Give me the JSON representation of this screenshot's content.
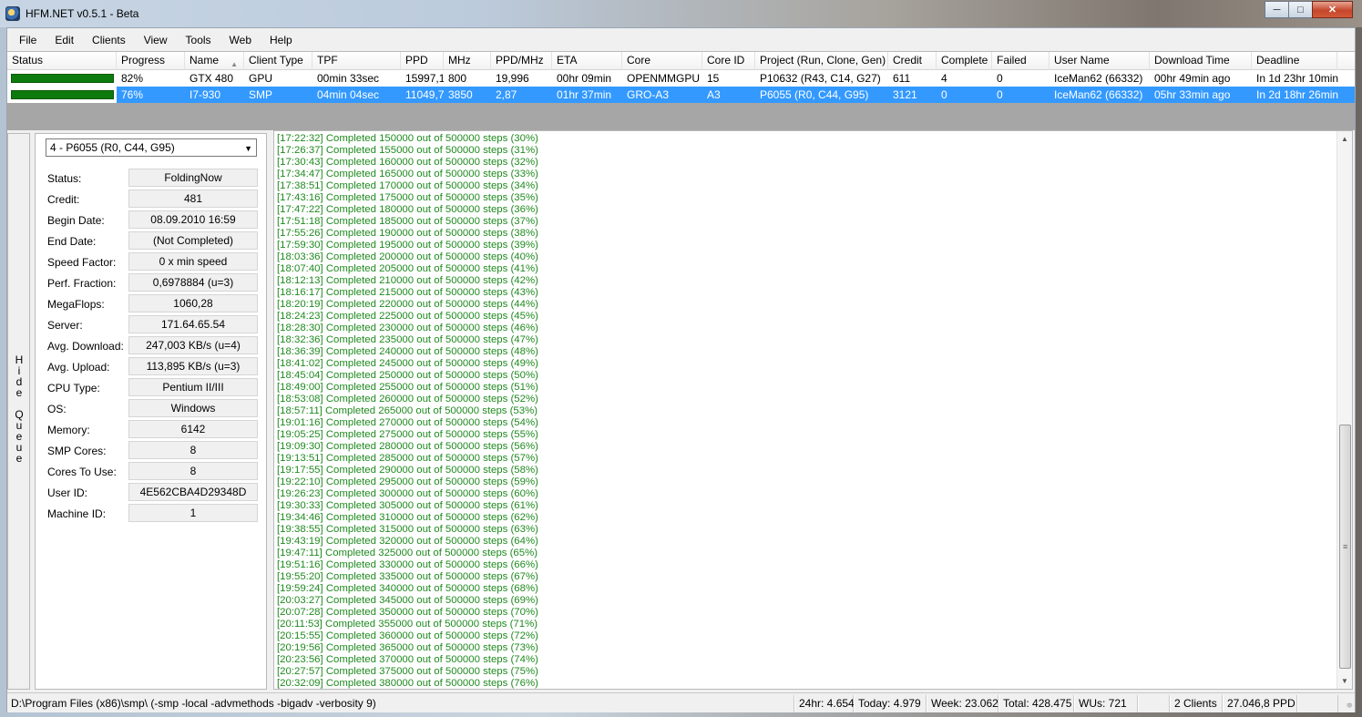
{
  "window": {
    "title": "HFM.NET v0.5.1 - Beta"
  },
  "menu": [
    "File",
    "Edit",
    "Clients",
    "View",
    "Tools",
    "Web",
    "Help"
  ],
  "grid": {
    "columns": [
      "Status",
      "Progress",
      "Name",
      "Client Type",
      "TPF",
      "PPD",
      "MHz",
      "PPD/MHz",
      "ETA",
      "Core",
      "Core ID",
      "Project (Run, Clone, Gen)",
      "Credit",
      "Complete",
      "Failed",
      "User Name",
      "Download Time",
      "Deadline"
    ],
    "rows": [
      [
        "",
        "82%",
        "GTX 480",
        "GPU",
        "00min 33sec",
        "15997,1",
        "800",
        "19,996",
        "00hr 09min",
        "OPENMMGPU",
        "15",
        "P10632 (R43, C14, G27)",
        "611",
        "4",
        "0",
        "IceMan62 (66332)",
        "00hr 49min ago",
        "In 1d 23hr 10min"
      ],
      [
        "",
        "76%",
        "I7-930",
        "SMP",
        "04min 04sec",
        "11049,7",
        "3850",
        "2,87",
        "01hr 37min",
        "GRO-A3",
        "A3",
        "P6055 (R0, C44, G95)",
        "3121",
        "0",
        "0",
        "IceMan62 (66332)",
        "05hr 33min ago",
        "In 2d 18hr 26min"
      ]
    ],
    "status_color": "#0d7a0d",
    "selection_color": "#3399ff"
  },
  "hide_queue": {
    "label": "Hide Queue"
  },
  "queue": {
    "selected": "4 - P6055 (R0, C44, G95)",
    "fields": [
      {
        "label": "Status:",
        "value": "FoldingNow"
      },
      {
        "label": "Credit:",
        "value": "481"
      },
      {
        "label": "Begin Date:",
        "value": "08.09.2010 16:59"
      },
      {
        "label": "End Date:",
        "value": "(Not Completed)"
      },
      {
        "label": "Speed Factor:",
        "value": "0 x min speed"
      },
      {
        "label": "Perf. Fraction:",
        "value": "0,6978884 (u=3)"
      },
      {
        "label": "MegaFlops:",
        "value": "1060,28"
      },
      {
        "label": "Server:",
        "value": "171.64.65.54"
      },
      {
        "label": "Avg. Download:",
        "value": "247,003 KB/s (u=4)"
      },
      {
        "label": "Avg. Upload:",
        "value": "113,895 KB/s (u=3)"
      },
      {
        "label": "CPU Type:",
        "value": "Pentium II/III"
      },
      {
        "label": "OS:",
        "value": "Windows"
      },
      {
        "label": "Memory:",
        "value": "6142"
      },
      {
        "label": "SMP Cores:",
        "value": "8"
      },
      {
        "label": "Cores To Use:",
        "value": "8"
      },
      {
        "label": "User ID:",
        "value": "4E562CBA4D29348D"
      },
      {
        "label": "Machine ID:",
        "value": "1"
      }
    ]
  },
  "log": {
    "color": "#1f8a1f",
    "lines": [
      "[17:22:32] Completed 150000 out of 500000 steps  (30%)",
      "[17:26:37] Completed 155000 out of 500000 steps  (31%)",
      "[17:30:43] Completed 160000 out of 500000 steps  (32%)",
      "[17:34:47] Completed 165000 out of 500000 steps  (33%)",
      "[17:38:51] Completed 170000 out of 500000 steps  (34%)",
      "[17:43:16] Completed 175000 out of 500000 steps  (35%)",
      "[17:47:22] Completed 180000 out of 500000 steps  (36%)",
      "[17:51:18] Completed 185000 out of 500000 steps  (37%)",
      "[17:55:26] Completed 190000 out of 500000 steps  (38%)",
      "[17:59:30] Completed 195000 out of 500000 steps  (39%)",
      "[18:03:36] Completed 200000 out of 500000 steps  (40%)",
      "[18:07:40] Completed 205000 out of 500000 steps  (41%)",
      "[18:12:13] Completed 210000 out of 500000 steps  (42%)",
      "[18:16:17] Completed 215000 out of 500000 steps  (43%)",
      "[18:20:19] Completed 220000 out of 500000 steps  (44%)",
      "[18:24:23] Completed 225000 out of 500000 steps  (45%)",
      "[18:28:30] Completed 230000 out of 500000 steps  (46%)",
      "[18:32:36] Completed 235000 out of 500000 steps  (47%)",
      "[18:36:39] Completed 240000 out of 500000 steps  (48%)",
      "[18:41:02] Completed 245000 out of 500000 steps  (49%)",
      "[18:45:04] Completed 250000 out of 500000 steps  (50%)",
      "[18:49:00] Completed 255000 out of 500000 steps  (51%)",
      "[18:53:08] Completed 260000 out of 500000 steps  (52%)",
      "[18:57:11] Completed 265000 out of 500000 steps  (53%)",
      "[19:01:16] Completed 270000 out of 500000 steps  (54%)",
      "[19:05:25] Completed 275000 out of 500000 steps  (55%)",
      "[19:09:30] Completed 280000 out of 500000 steps  (56%)",
      "[19:13:51] Completed 285000 out of 500000 steps  (57%)",
      "[19:17:55] Completed 290000 out of 500000 steps  (58%)",
      "[19:22:10] Completed 295000 out of 500000 steps  (59%)",
      "[19:26:23] Completed 300000 out of 500000 steps  (60%)",
      "[19:30:33] Completed 305000 out of 500000 steps  (61%)",
      "[19:34:46] Completed 310000 out of 500000 steps  (62%)",
      "[19:38:55] Completed 315000 out of 500000 steps  (63%)",
      "[19:43:19] Completed 320000 out of 500000 steps  (64%)",
      "[19:47:11] Completed 325000 out of 500000 steps  (65%)",
      "[19:51:16] Completed 330000 out of 500000 steps  (66%)",
      "[19:55:20] Completed 335000 out of 500000 steps  (67%)",
      "[19:59:24] Completed 340000 out of 500000 steps  (68%)",
      "[20:03:27] Completed 345000 out of 500000 steps  (69%)",
      "[20:07:28] Completed 350000 out of 500000 steps  (70%)",
      "[20:11:53] Completed 355000 out of 500000 steps  (71%)",
      "[20:15:55] Completed 360000 out of 500000 steps  (72%)",
      "[20:19:56] Completed 365000 out of 500000 steps  (73%)",
      "[20:23:56] Completed 370000 out of 500000 steps  (74%)",
      "[20:27:57] Completed 375000 out of 500000 steps  (75%)",
      "[20:32:09] Completed 380000 out of 500000 steps  (76%)"
    ]
  },
  "statusbar": {
    "path": "D:\\Program Files (x86)\\smp\\ (-smp -local -advmethods -bigadv -verbosity 9)",
    "h24": "24hr: 4.654",
    "today": "Today: 4.979",
    "week": "Week: 23.062",
    "total": "Total: 428.475",
    "wus": "WUs: 721",
    "clients": "2 Clients",
    "ppd": "27.046,8 PPD"
  }
}
